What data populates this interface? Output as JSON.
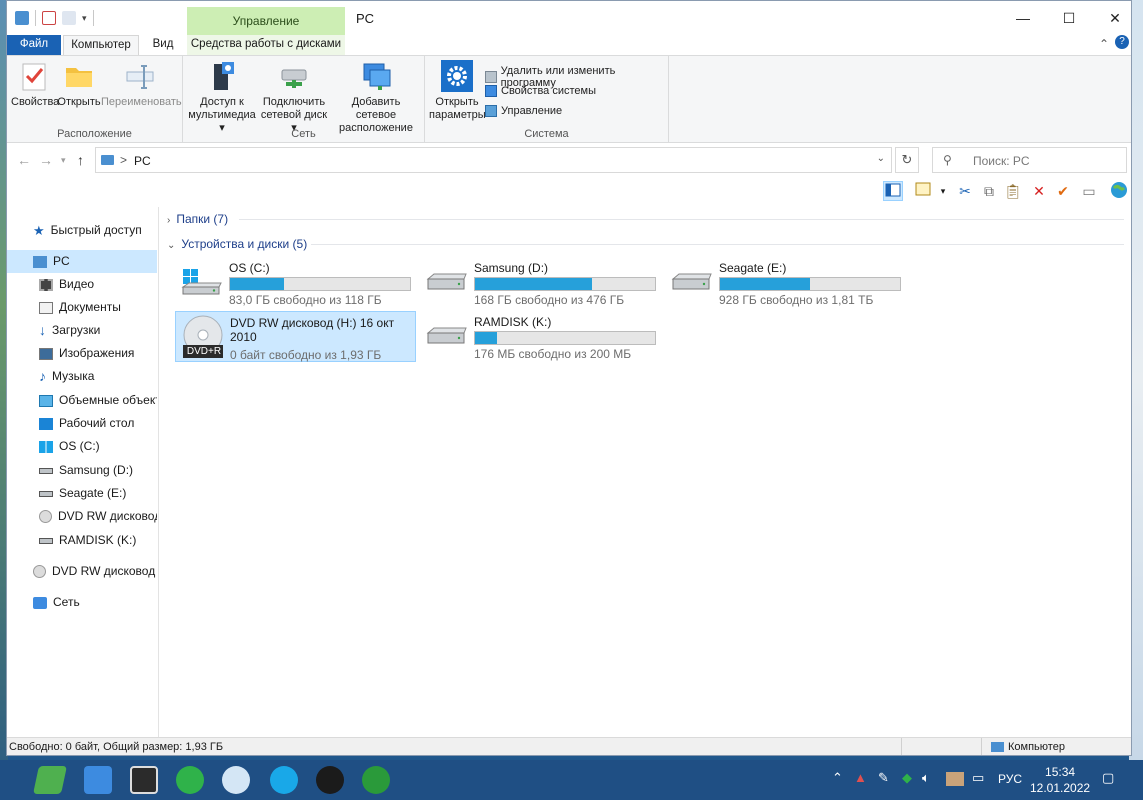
{
  "window": {
    "title": "PC",
    "context_tab": "Управление",
    "buttons": {
      "minimize": "—",
      "maximize": "☐",
      "close": "✕"
    }
  },
  "ribbon_tabs": {
    "file": "Файл",
    "computer": "Компьютер",
    "view": "Вид",
    "disk_tools": "Средства работы с дисками"
  },
  "ribbon": {
    "location": {
      "label": "Расположение",
      "properties": "Свойства",
      "open": "Открыть",
      "rename": "Переименовать"
    },
    "network": {
      "label": "Сеть",
      "media_access_line1": "Доступ к",
      "media_access_line2": "мультимедиа",
      "map_drive_line1": "Подключить",
      "map_drive_line2": "сетевой диск",
      "add_location_line1": "Добавить сетевое",
      "add_location_line2": "расположение"
    },
    "system": {
      "label": "Система",
      "open_settings_line1": "Открыть",
      "open_settings_line2": "параметры",
      "uninstall": "Удалить или изменить программу",
      "system_props": "Свойства системы",
      "manage": "Управление"
    }
  },
  "address": {
    "separator": ">",
    "crumb": "PC",
    "search_placeholder": "Поиск: PC"
  },
  "nav_pane": {
    "items": [
      {
        "label": "Быстрый доступ",
        "icon": "star-icon"
      },
      {
        "label": "PC",
        "icon": "computer-icon"
      },
      {
        "label": "Видео",
        "icon": "video-icon"
      },
      {
        "label": "Документы",
        "icon": "documents-icon"
      },
      {
        "label": "Загрузки",
        "icon": "downloads-icon"
      },
      {
        "label": "Изображения",
        "icon": "pictures-icon"
      },
      {
        "label": "Музыка",
        "icon": "music-icon"
      },
      {
        "label": "Объемные объект",
        "icon": "3d-objects-icon"
      },
      {
        "label": "Рабочий стол",
        "icon": "desktop-icon"
      },
      {
        "label": "OS (C:)",
        "icon": "windows-drive-icon"
      },
      {
        "label": "Samsung (D:)",
        "icon": "drive-icon"
      },
      {
        "label": "Seagate (E:)",
        "icon": "drive-icon"
      },
      {
        "label": "DVD RW дисковод",
        "icon": "dvd-icon"
      },
      {
        "label": "RAMDISK (K:)",
        "icon": "drive-icon"
      },
      {
        "label": "DVD RW дисковод (",
        "icon": "dvd-icon"
      },
      {
        "label": "Сеть",
        "icon": "network-icon"
      }
    ]
  },
  "content": {
    "folders_header": "Папки (7)",
    "devices_header": "Устройства и диски (5)",
    "drives": [
      {
        "name": "OS (C:)",
        "free": "83,0 ГБ свободно из 118 ГБ",
        "used_fraction": 0.3
      },
      {
        "name": "Samsung (D:)",
        "free": "168 ГБ свободно из 476 ГБ",
        "used_fraction": 0.65
      },
      {
        "name": "Seagate (E:)",
        "free": "928 ГБ свободно из 1,81 ТБ",
        "used_fraction": 0.5
      },
      {
        "name_line1": "DVD RW дисковод (H:) 16 окт",
        "name_line2": "2010",
        "free": "0 байт свободно из 1,93 ГБ",
        "badge": "DVD+R"
      },
      {
        "name": "RAMDISK (K:)",
        "free": "176 МБ свободно из 200 МБ",
        "used_fraction": 0.12
      }
    ]
  },
  "status_bar": {
    "text": "Свободно: 0 байт, Общий размер: 1,93 ГБ",
    "location": "Компьютер"
  },
  "taskbar": {
    "lang": "РУС",
    "time": "15:34",
    "date": "12.01.2022"
  },
  "colors": {
    "accent": "#1a62b4",
    "bar_fill": "#26a0da",
    "selection": "#cce8ff",
    "context_tab": "#cdeeb4"
  }
}
